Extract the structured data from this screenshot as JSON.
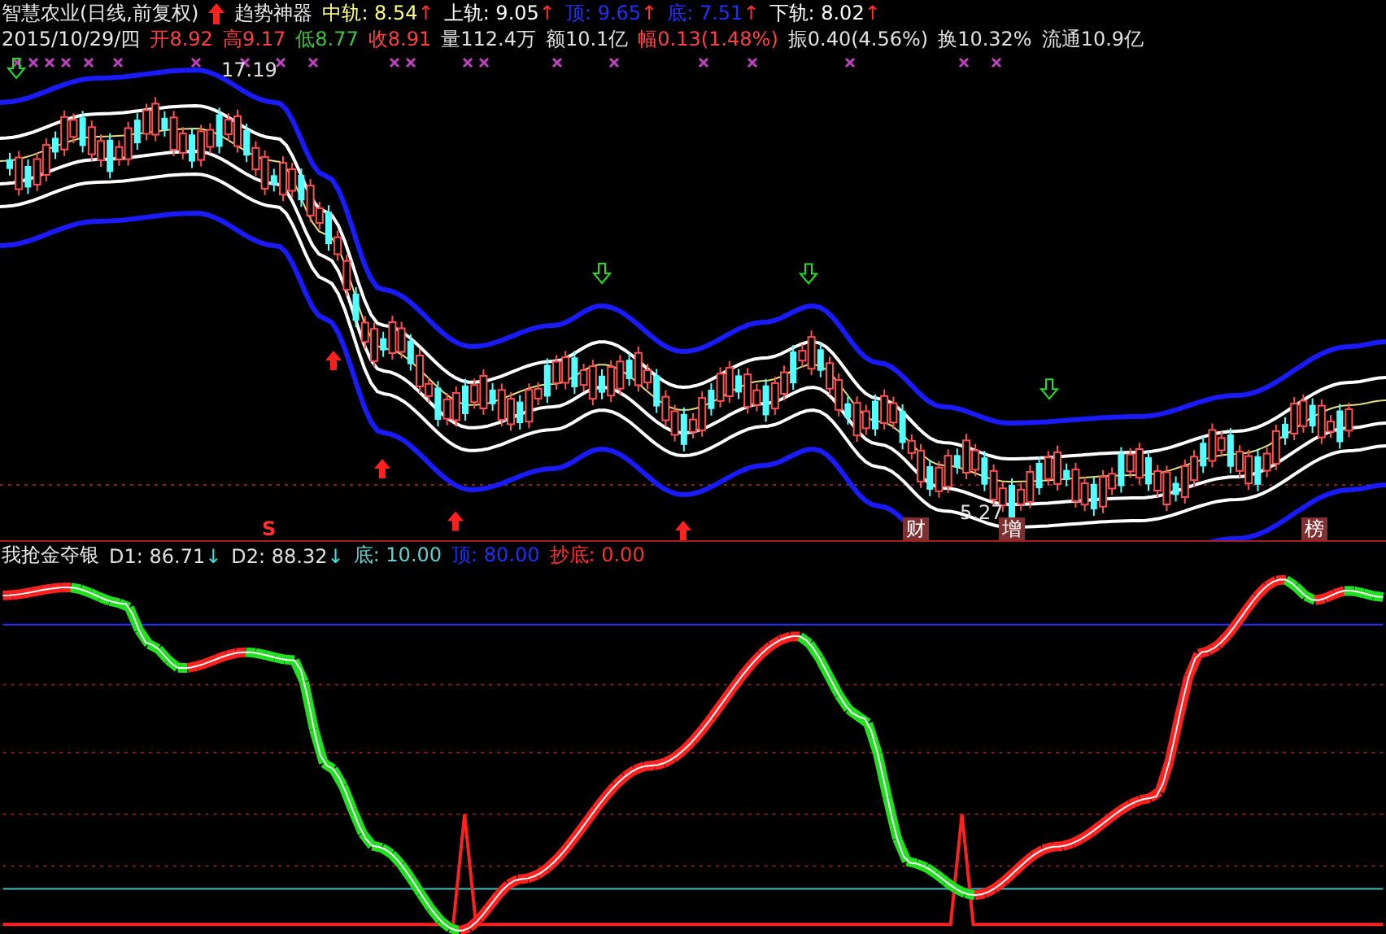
{
  "header": {
    "stock": "智慧农业(日线,前复权)",
    "indicator": "趋势神器",
    "lines": [
      {
        "label": "中轨: ",
        "value": "8.54",
        "arrow": "↑",
        "color": "#ffff80"
      },
      {
        "label": "上轨: ",
        "value": "9.05",
        "arrow": "↑",
        "color": "#ffffff"
      },
      {
        "label": "顶: ",
        "value": "9.65",
        "arrow": "↑",
        "color": "#2030ff"
      },
      {
        "label": "底: ",
        "value": "7.51",
        "arrow": "↑",
        "color": "#2030ff"
      },
      {
        "label": "下轨: ",
        "value": "8.02",
        "arrow": "↑",
        "color": "#ffffff"
      }
    ]
  },
  "quote": {
    "date": "2015/10/29/四",
    "fields": [
      {
        "label": "开",
        "value": "8.92",
        "color": "#ff4040"
      },
      {
        "label": "高",
        "value": "9.17",
        "color": "#ff4040"
      },
      {
        "label": "低",
        "value": "8.77",
        "color": "#40c040"
      },
      {
        "label": "收",
        "value": "8.91",
        "color": "#ff4040"
      },
      {
        "label": "量",
        "value": "112.4万",
        "color": "#e0e0e0"
      },
      {
        "label": "额",
        "value": "10.1亿",
        "color": "#e0e0e0"
      },
      {
        "label": "幅",
        "value": "0.13(1.48%)",
        "color": "#ff4040"
      },
      {
        "label": "振",
        "value": "0.40(4.56%)",
        "color": "#e0e0e0"
      },
      {
        "label": "换",
        "value": "10.32%",
        "color": "#e0e0e0"
      },
      {
        "label": "流通",
        "value": "10.9亿",
        "color": "#e0e0e0"
      }
    ]
  },
  "chart_labels": [
    {
      "text": "17.19",
      "kind": "price"
    },
    {
      "text": "5.27",
      "kind": "price"
    },
    {
      "text": "S",
      "kind": "signal"
    },
    {
      "text": "财",
      "kind": "badge"
    },
    {
      "text": "增",
      "kind": "badge"
    },
    {
      "text": "榜",
      "kind": "badge"
    }
  ],
  "oscillator": {
    "name": "我抢金夺银",
    "lines": [
      {
        "label": "D1: ",
        "value": "86.71",
        "arrow": "↓",
        "color": "#e0e0e0"
      },
      {
        "label": "D2: ",
        "value": "88.32",
        "arrow": "↓",
        "color": "#e0e0e0"
      },
      {
        "label": "底: ",
        "value": "10.00",
        "color": "#60d0d0"
      },
      {
        "label": "顶: ",
        "value": "80.00",
        "color": "#2030ff"
      },
      {
        "label": "抄底: ",
        "value": "0.00",
        "color": "#ff3030"
      }
    ]
  }
}
